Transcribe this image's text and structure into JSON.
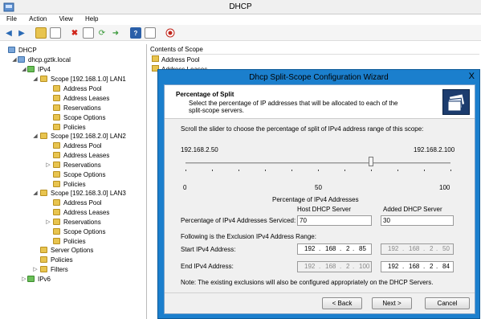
{
  "window": {
    "title": "DHCP"
  },
  "menu": [
    "File",
    "Action",
    "View",
    "Help"
  ],
  "toolbar": [
    "back-arrow-icon",
    "forward-arrow-icon",
    "folder-up-icon",
    "show-hide-tree-icon",
    "delete-icon",
    "properties-icon",
    "refresh-icon",
    "export-icon",
    "help-icon",
    "pane-icon",
    "stop-icon"
  ],
  "tree": {
    "root": "DHCP",
    "server": "dhcp.gztk.local",
    "ipv4": "IPv4",
    "scopes": [
      {
        "label": "Scope [192.168.1.0] LAN1",
        "children": [
          "Address Pool",
          "Address Leases",
          "Reservations",
          "Scope Options",
          "Policies"
        ]
      },
      {
        "label": "Scope [192.168.2.0] LAN2",
        "children": [
          "Address Pool",
          "Address Leases",
          "Reservations",
          "Scope Options",
          "Policies"
        ]
      },
      {
        "label": "Scope [192.168.3.0] LAN3",
        "children": [
          "Address Pool",
          "Address Leases",
          "Reservations",
          "Scope Options",
          "Policies"
        ]
      }
    ],
    "after": [
      "Server Options",
      "Policies",
      "Filters"
    ],
    "ipv6": "IPv6"
  },
  "list": {
    "header": "Contents of Scope",
    "items": [
      "Address Pool",
      "Address Leases"
    ]
  },
  "wizard": {
    "title": "Dhcp Split-Scope Configuration Wizard",
    "close": "X",
    "header_title": "Percentage of Split",
    "header_desc_1": "Select the percentage of IP addresses that will be allocated to each of the",
    "header_desc_2": "split-scope servers.",
    "instruction": "Scroll the slider to choose the percentage of split of IPv4 address range of this scope:",
    "range_start": "192.168.2.50",
    "range_end": "192.168.2.100",
    "slider": {
      "value": 70,
      "min_label": "0",
      "mid_label": "50",
      "max_label": "100"
    },
    "pct_heading": "Percentage of IPv4 Addresses",
    "host_header": "Host DHCP Server",
    "added_header": "Added DHCP Server",
    "pct_label": "Percentage of IPv4 Addresses Serviced:",
    "host_pct": "70",
    "added_pct": "30",
    "exclusion_heading": "Following is the Exclusion IPv4 Address Range:",
    "start_label": "Start IPv4 Address:",
    "end_label": "End IPv4 Address:",
    "host_start": [
      "192",
      "168",
      "2",
      "85"
    ],
    "added_start": [
      "192",
      "168",
      "2",
      "50"
    ],
    "host_end": [
      "192",
      "168",
      "2",
      "100"
    ],
    "added_end": [
      "192",
      "168",
      "2",
      "84"
    ],
    "note": "Note: The existing exclusions will also be configured appropriately on the DHCP Servers.",
    "back": "< Back",
    "next": "Next >",
    "cancel": "Cancel"
  }
}
